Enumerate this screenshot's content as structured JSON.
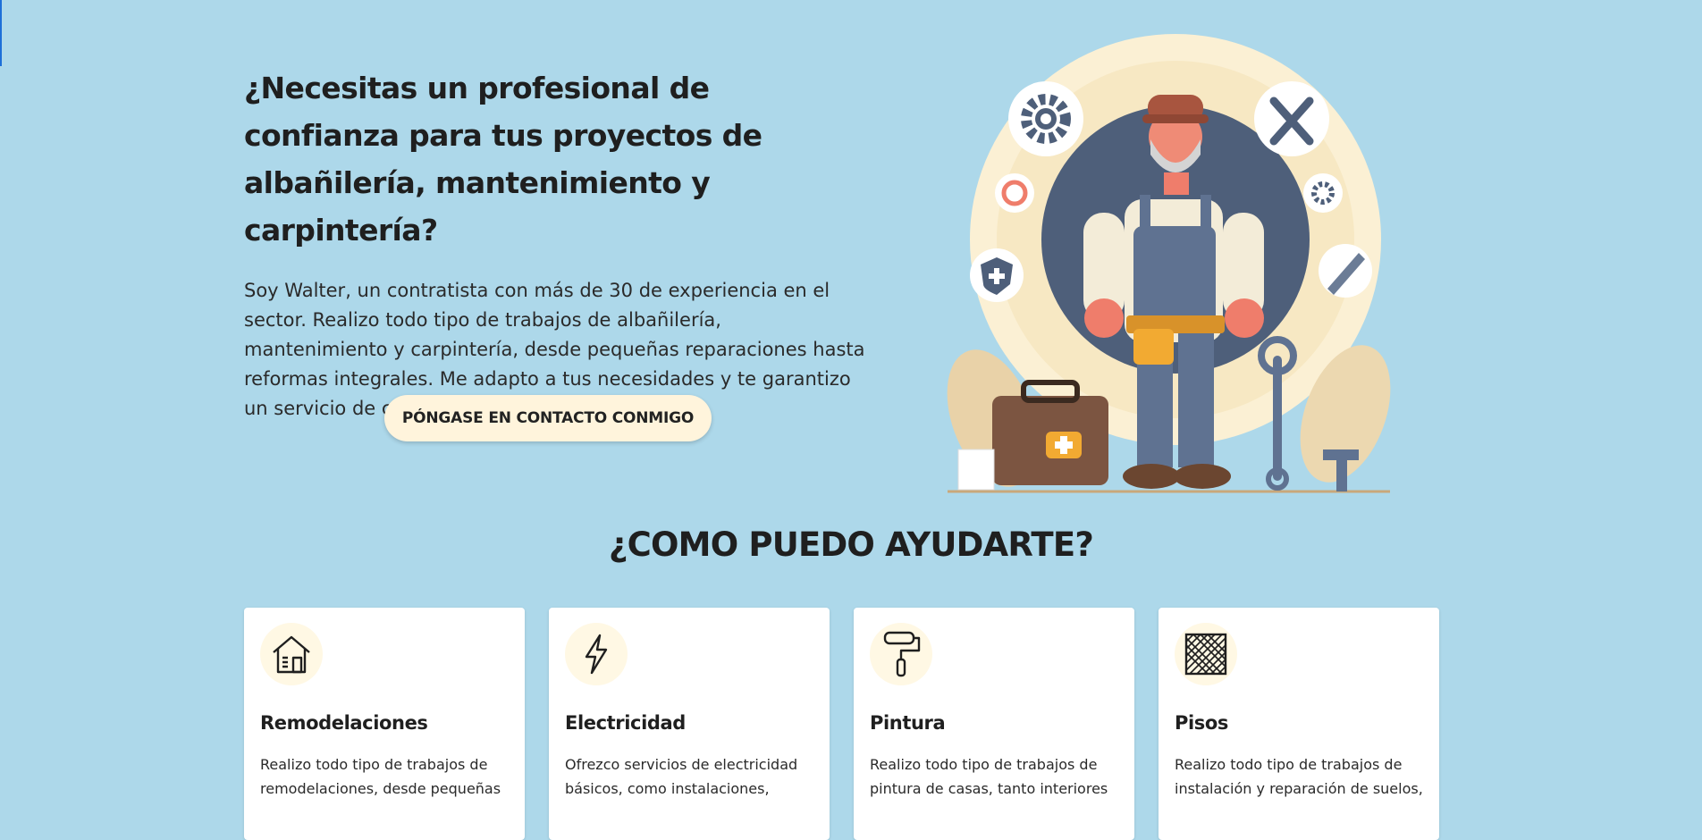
{
  "hero": {
    "title": "¿Necesitas un profesional de confianza para tus proyectos de albañilería, mantenimiento y carpintería?",
    "description": "Soy Walter, un contratista con más de 30 de experiencia en el sector. Realizo todo tipo de trabajos de albañilería, mantenimiento y carpintería, desde pequeñas reparaciones hasta reformas integrales. Me adapto a tus necesidades y te garantizo un servicio de calidad y puntualidad.",
    "cta_label": "PÓNGASE EN CONTACTO CONMIGO",
    "illustration_icon": "handyman-illustration"
  },
  "services": {
    "title": "¿COMO PUEDO AYUDARTE?",
    "items": [
      {
        "icon": "house-icon",
        "title": "Remodelaciones",
        "text": "Realizo todo tipo de trabajos de remodelaciones, desde pequeñas"
      },
      {
        "icon": "lightning-icon",
        "title": "Electricidad",
        "text": "Ofrezco servicios de electricidad básicos, como instalaciones,"
      },
      {
        "icon": "paint-roller-icon",
        "title": "Pintura",
        "text": "Realizo todo tipo de trabajos de pintura de casas, tanto interiores"
      },
      {
        "icon": "floor-tiles-icon",
        "title": "Pisos",
        "text": "Realizo todo tipo de trabajos de instalación y reparación de suelos,"
      }
    ]
  },
  "colors": {
    "background": "#add8ea",
    "cta_background": "#fff4dc",
    "card_background": "#ffffff",
    "icon_circle": "#fff8e4",
    "accent_blue": "#1d6fd8"
  }
}
